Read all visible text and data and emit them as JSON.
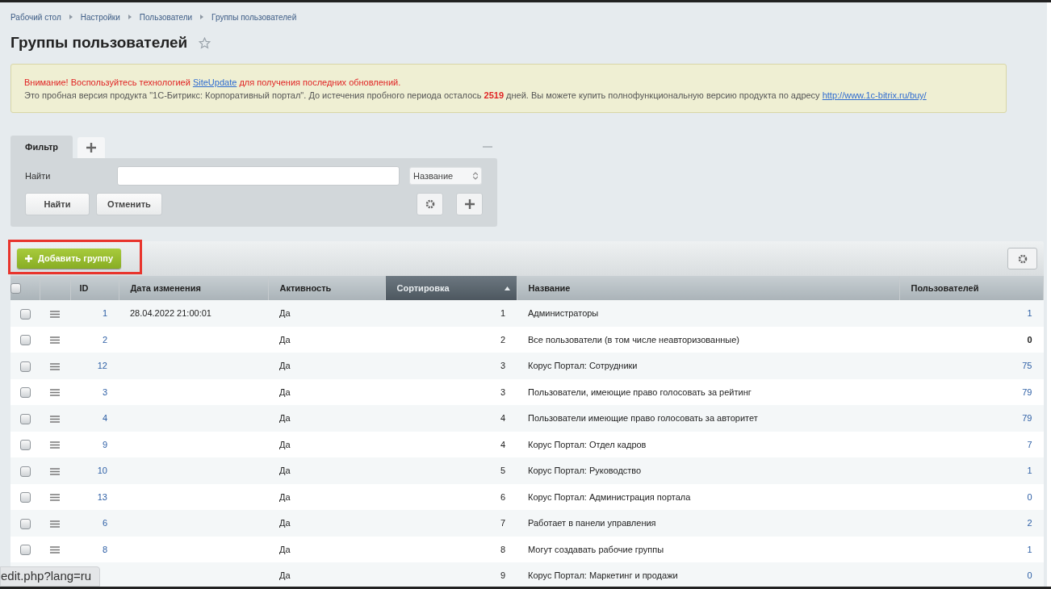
{
  "breadcrumbs": [
    "Рабочий стол",
    "Настройки",
    "Пользователи",
    "Группы пользователей"
  ],
  "title": "Группы пользователей",
  "favorite": false,
  "alert": {
    "warning_parts": [
      "Внимание! Воспользуйтесь технологией ",
      "SiteUpdate",
      " для получения последних обновлений."
    ],
    "trial_before": "Это пробная версия продукта \"1С-Битрикс: Корпоративный портал\". До истечения пробного периода осталось ",
    "days": "2519",
    "trial_after": " дней. Вы можете купить полнофункциональную версию продукта по адресу ",
    "url": "http://www.1c-bitrix.ru/buy/"
  },
  "filter": {
    "tabs": [
      {
        "label": "Фильтр",
        "selected": true
      }
    ],
    "find_label": "Найти",
    "field_select": "Название",
    "buttons": [
      "Найти",
      "Отменить"
    ]
  },
  "add_button": "Добавить группу",
  "table": {
    "columns": [
      {
        "kind": "checkbox",
        "sorted": false,
        "checked": false
      },
      {
        "kind": "menu",
        "sorted": false
      },
      {
        "label": "ID",
        "kind": "id",
        "sorted": false
      },
      {
        "label": "Дата изменения",
        "kind": "date",
        "sorted": false
      },
      {
        "label": "Активность",
        "kind": "text",
        "sorted": false
      },
      {
        "label": "Сортировка",
        "kind": "num",
        "sorted": true
      },
      {
        "label": "Название",
        "kind": "text",
        "sorted": false
      },
      {
        "label": "Пользователей",
        "kind": "users",
        "sorted": false
      }
    ],
    "rows": [
      {
        "checked": false,
        "id": "1",
        "date": "28.04.2022 21:00:01",
        "active": "Да",
        "sort": "1",
        "name": "Администраторы",
        "users": "1",
        "users_link": true
      },
      {
        "checked": false,
        "id": "2",
        "active": "Да",
        "sort": "2",
        "name": "Все пользователи (в том числе неавторизованные)",
        "users": "0",
        "users_link": false
      },
      {
        "checked": false,
        "id": "12",
        "active": "Да",
        "sort": "3",
        "name": "Корус Портал: Сотрудники",
        "users": "75",
        "users_link": true
      },
      {
        "checked": false,
        "id": "3",
        "active": "Да",
        "sort": "3",
        "name": "Пользователи, имеющие право голосовать за рейтинг",
        "users": "79",
        "users_link": true
      },
      {
        "checked": false,
        "id": "4",
        "active": "Да",
        "sort": "4",
        "name": "Пользователи имеющие право голосовать за авторитет",
        "users": "79",
        "users_link": true
      },
      {
        "checked": false,
        "id": "9",
        "active": "Да",
        "sort": "4",
        "name": "Корус Портал: Отдел кадров",
        "users": "7",
        "users_link": true
      },
      {
        "checked": false,
        "id": "10",
        "active": "Да",
        "sort": "5",
        "name": "Корус Портал: Руководство",
        "users": "1",
        "users_link": true
      },
      {
        "checked": false,
        "id": "13",
        "active": "Да",
        "sort": "6",
        "name": "Корус Портал: Администрация портала",
        "users": "0",
        "users_link": true
      },
      {
        "checked": false,
        "id": "6",
        "active": "Да",
        "sort": "7",
        "name": "Работает в панели управления",
        "users": "2",
        "users_link": true
      },
      {
        "checked": false,
        "id": "8",
        "active": "Да",
        "sort": "8",
        "name": "Могут создавать рабочие группы",
        "users": "1",
        "users_link": true
      },
      {
        "active": "Да",
        "sort": "9",
        "name": "Корус Портал: Маркетинг и продажи",
        "users": "0",
        "users_link": true
      }
    ]
  },
  "status_url": "edit.php?lang=ru"
}
